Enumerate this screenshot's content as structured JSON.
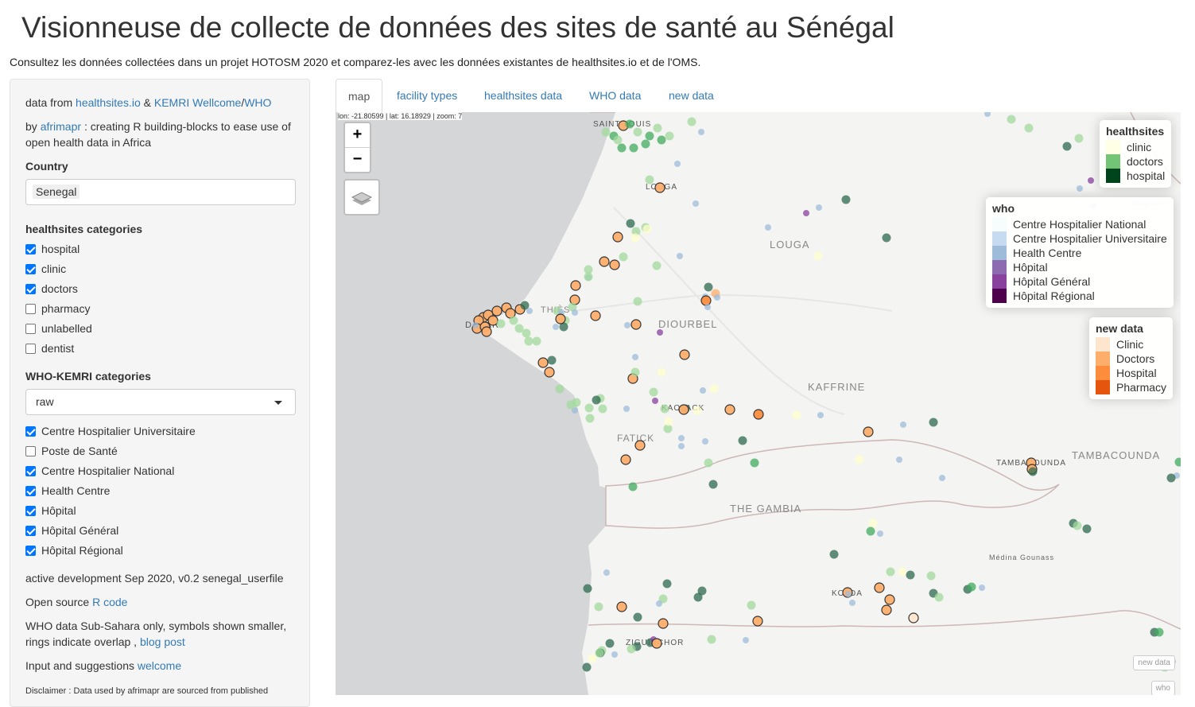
{
  "header": {
    "title": "Visionneuse de collecte de données des sites de santé au Sénégal",
    "subtitle": "Consultez les données collectées dans un projet HOTOSM 2020 et comparez-les avec les données existantes de healthsites.io et de l'OMS."
  },
  "sidebar": {
    "data_from_prefix": "data from",
    "link_healthsites": "healthsites.io",
    "amp": "&",
    "link_kemri": "KEMRI Wellcome",
    "slash": "/",
    "link_who": "WHO",
    "by_prefix": "by",
    "link_afrimapr": "afrimapr",
    "by_suffix": ": creating R building-blocks to ease use of open health data in Africa",
    "country_label": "Country",
    "country_value": "Senegal",
    "hs_label": "healthsites categories",
    "hs_items": [
      {
        "label": "hospital",
        "checked": true
      },
      {
        "label": "clinic",
        "checked": true
      },
      {
        "label": "doctors",
        "checked": true
      },
      {
        "label": "pharmacy",
        "checked": false
      },
      {
        "label": "unlabelled",
        "checked": false
      },
      {
        "label": "dentist",
        "checked": false
      }
    ],
    "who_label": "WHO-KEMRI categories",
    "who_select": "raw",
    "who_items": [
      {
        "label": "Centre Hospitalier Universitaire",
        "checked": true
      },
      {
        "label": "Poste de Santé",
        "checked": false
      },
      {
        "label": "Centre Hospitalier National",
        "checked": true
      },
      {
        "label": "Health Centre",
        "checked": true
      },
      {
        "label": "Hôpital",
        "checked": true
      },
      {
        "label": "Hôpital Général",
        "checked": true
      },
      {
        "label": "Hôpital Régional",
        "checked": true
      }
    ],
    "dev_note": "active development Sep 2020, v0.2 senegal_userfile",
    "open_source_prefix": "Open source",
    "link_rcode": "R code",
    "who_note": "WHO data Sub-Sahara only, symbols shown smaller, rings indicate overlap ,",
    "link_blog": "blog post",
    "input_prefix": "Input and suggestions",
    "link_welcome": "welcome",
    "disclaimer": "Disclaimer : Data used by afrimapr are sourced from published"
  },
  "tabs": [
    {
      "label": "map",
      "active": true
    },
    {
      "label": "facility types",
      "active": false
    },
    {
      "label": "healthsites data",
      "active": false
    },
    {
      "label": "WHO data",
      "active": false
    },
    {
      "label": "new data",
      "active": false
    }
  ],
  "map": {
    "coords": "lon: -21.80599 | lat: 16.18929 | zoom: 7",
    "zoom_in": "+",
    "zoom_out": "−",
    "places": {
      "saint_louis": "SAINT-LOUIS",
      "louga_city": "LOUGA",
      "louga": "LOUGA",
      "thies": "THIÈS",
      "dakar": "DAKAR",
      "diourbel": "DIOURBEL",
      "kaolack": "KAOLACK",
      "fatick": "FATICK",
      "kaffrine": "KAFFRINE",
      "tambacounda_city": "TAMBACOUNDA",
      "tambacounda": "TAMBACOUNDA",
      "gambia": "THE GAMBIA",
      "kolda": "KOLDA",
      "ziguinchor": "ZIGUINCHOR",
      "medina": "Médina Gounass",
      "maghama": "Maghama"
    },
    "mini_new": "new data",
    "mini_who": "who"
  },
  "legend_hs": {
    "title": "healthsites",
    "items": [
      {
        "label": "clinic",
        "color": "#ffffe5"
      },
      {
        "label": "doctors",
        "color": "#74c476"
      },
      {
        "label": "hospital",
        "color": "#00441b"
      }
    ]
  },
  "legend_who": {
    "title": "who",
    "items": [
      {
        "label": "Centre Hospitalier National",
        "color": "#f7fcfd"
      },
      {
        "label": "Centre Hospitalier Universitaire",
        "color": "#c6dbef"
      },
      {
        "label": "Health Centre",
        "color": "#9ebcda"
      },
      {
        "label": "Hôpital",
        "color": "#8c6bb1"
      },
      {
        "label": "Hôpital Général",
        "color": "#88419d"
      },
      {
        "label": "Hôpital Régional",
        "color": "#4d004b"
      }
    ]
  },
  "legend_new": {
    "title": "new data",
    "items": [
      {
        "label": "Clinic",
        "color": "#fee6ce"
      },
      {
        "label": "Doctors",
        "color": "#fdae6b"
      },
      {
        "label": "Hospital",
        "color": "#fd8d3c"
      },
      {
        "label": "Pharmacy",
        "color": "#e6550d"
      }
    ]
  }
}
